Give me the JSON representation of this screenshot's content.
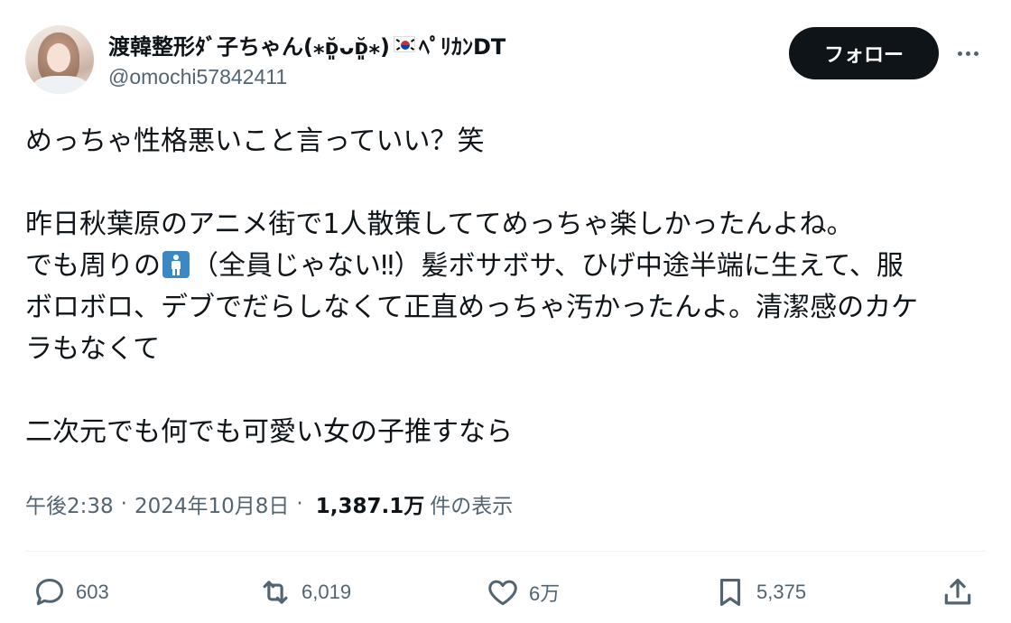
{
  "user": {
    "display_name": "渡韓整形ﾀﾞ子ちゃん(⁎ᴅ͈̆ᴗᴅ͈̆⁎)",
    "name_suffix": "ﾍﾟﾘｶﾝDT",
    "handle": "@omochi57842411",
    "follow_label": "フォロー"
  },
  "tweet": {
    "line1": "めっちゃ性格悪いこと言っていい？笑",
    "line2": "昨日秋葉原のアニメ街で1人散策しててめっちゃ楽しかったんよね。",
    "line3_pre": "でも周りの",
    "line3_post": "（全員じゃない‼︎）髪ボサボサ、ひげ中途半端に生えて、服",
    "line4": "ボロボロ、デブでだらしなくて正直めっちゃ汚かったんよ。清潔感のカケ",
    "line5": "ラもなくて",
    "line6": "二次元でも何でも可愛い女の子推すなら"
  },
  "meta": {
    "time": "午後2:38",
    "date": "2024年10月8日",
    "views": "1,387.1万",
    "views_label": "件の表示",
    "separator": "·"
  },
  "actions": {
    "replies": "603",
    "retweets": "6,019",
    "likes": "6万",
    "bookmarks": "5,375"
  },
  "icons": [
    "reply-icon",
    "retweet-icon",
    "like-icon",
    "bookmark-icon",
    "share-icon",
    "more-icon",
    "man-emoji-icon",
    "korea-flag-icon"
  ],
  "colors": {
    "text": "#0f1419",
    "secondary": "#536471",
    "follow_bg": "#0f1419",
    "emoji_blue": "#3b88c3"
  }
}
